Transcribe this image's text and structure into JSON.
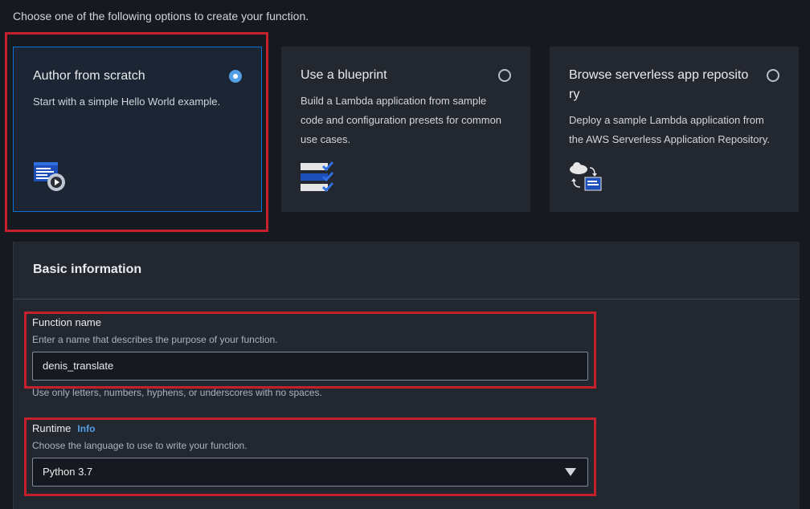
{
  "intro": "Choose one of the following options to create your function.",
  "options": [
    {
      "title": "Author from scratch",
      "description": "Start with a simple Hello World example.",
      "selected": true,
      "icon": "code-gear-icon"
    },
    {
      "title": "Use a blueprint",
      "description": "Build a Lambda application from sample code and configuration presets for common use cases.",
      "selected": false,
      "icon": "checklist-icon"
    },
    {
      "title": "Browse serverless app repository",
      "description": "Deploy a sample Lambda application from the AWS Serverless Application Repository.",
      "selected": false,
      "icon": "cloud-sync-icon"
    }
  ],
  "basic_info": {
    "title": "Basic information",
    "function_name": {
      "label": "Function name",
      "description": "Enter a name that describes the purpose of your function.",
      "value": "denis_translate",
      "constraint": "Use only letters, numbers, hyphens, or underscores with no spaces."
    },
    "runtime": {
      "label": "Runtime",
      "info": "Info",
      "description": "Choose the language to use to write your function.",
      "value": "Python 3.7"
    }
  },
  "colors": {
    "highlight": "#c5212c",
    "accent": "#539fe5",
    "background": "#16191f",
    "card": "#232730"
  }
}
